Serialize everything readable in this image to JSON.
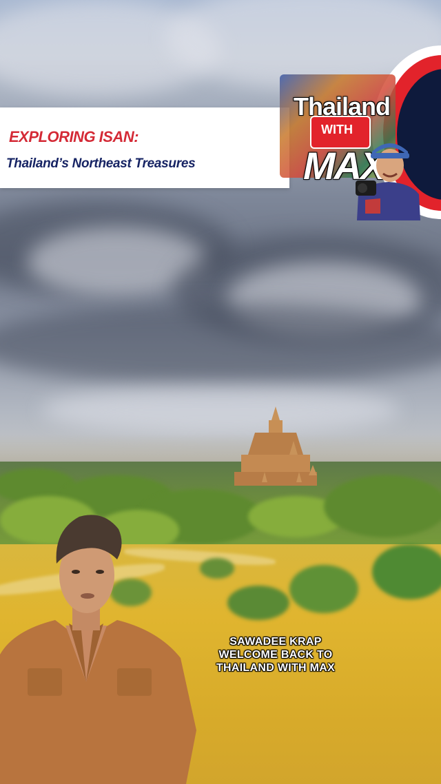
{
  "banner": {
    "title": "EXPLORING ISAN:",
    "subtitle": "Thailand’s Northeast Treasures"
  },
  "logo": {
    "line1": "Thailand",
    "line2": "WITH",
    "line3": "MAX"
  },
  "caption": {
    "lines": [
      "SAWADEE KRAP",
      "WELCOME BACK TO",
      "THAILAND WITH MAX"
    ]
  },
  "colors": {
    "title_red": "#d42a36",
    "subtitle_navy": "#172464",
    "field_gold": "#dcb233",
    "logo_red": "#e2232b"
  }
}
